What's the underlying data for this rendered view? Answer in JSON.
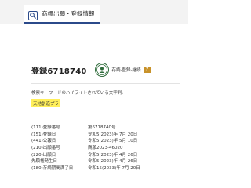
{
  "tab": {
    "label": "商標出願・登録情報",
    "icon": "search-icon"
  },
  "registration": {
    "number": "登録6718740",
    "badge_icon": "registration-seal-icon",
    "status": "存続-登録-継続",
    "help_icon": "help-icon",
    "help_symbol": "?"
  },
  "highlight": {
    "note": "検索キーワードのハイライトされている文字列:",
    "keyword": "天地創造プラ"
  },
  "info_rows": [
    {
      "key": "(111)登録番号",
      "value": "第6718740号"
    },
    {
      "key": "(151)登録日",
      "value": "令和5(2023)年 7月 20日"
    },
    {
      "key": "(441)公報日",
      "value": "令和5(2023)年 5月 10日"
    },
    {
      "key": "(210)出願番号",
      "value": "商願2023-46020"
    },
    {
      "key": "(220)出願日",
      "value": "令和5(2023)年 4月 26日"
    },
    {
      "key": "先願権発生日",
      "value": "令和5(2023)年 4月 26日"
    },
    {
      "key": "(180)存続期間満了日",
      "value": "令和15(2033)年 7月 20日"
    }
  ],
  "colors": {
    "accent": "#2b4a8a",
    "seal": "#2e6b3a",
    "help": "#c8922a",
    "highlight": "#ffef5a"
  }
}
